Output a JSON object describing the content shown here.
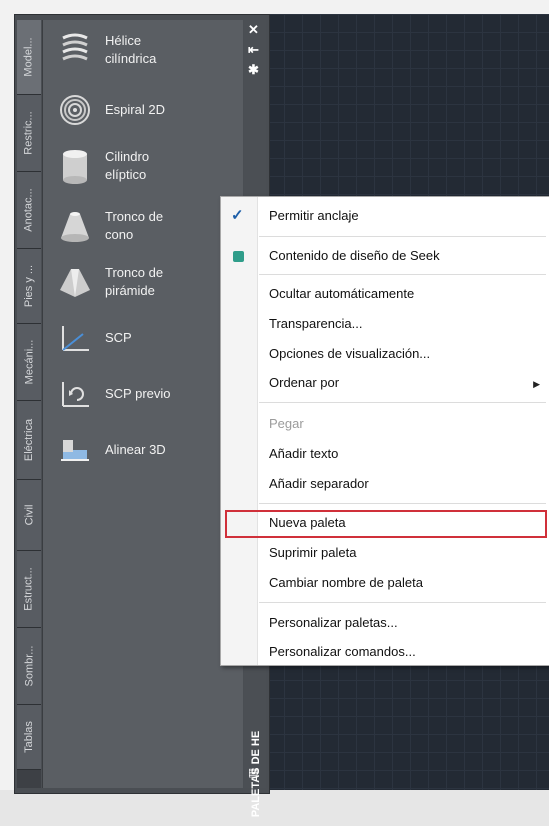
{
  "palette": {
    "title": "PALETAS DE HE",
    "tabs": [
      "Model...",
      "Restric...",
      "Anotac...",
      "Pies y ...",
      "Mecáni...",
      "Eléctrica",
      "Civil",
      "Estruct...",
      "Sombr...",
      "Tablas"
    ],
    "tools": [
      {
        "label": "Hélice\ncilíndrica",
        "icon": "helix-icon"
      },
      {
        "label": "Espiral 2D",
        "icon": "spiral-2d-icon"
      },
      {
        "label": "Cilindro\nelíptico",
        "icon": "elliptical-cylinder-icon"
      },
      {
        "label": "Tronco de\ncono",
        "icon": "cone-frustum-icon"
      },
      {
        "label": "Tronco de\npirámide",
        "icon": "pyramid-frustum-icon"
      },
      {
        "label": "SCP",
        "icon": "ucs-icon"
      },
      {
        "label": "SCP previo",
        "icon": "ucs-previous-icon"
      },
      {
        "label": "Alinear 3D",
        "icon": "align-3d-icon"
      }
    ],
    "titlebar_icons": [
      "close-icon",
      "autohide-icon",
      "properties-icon"
    ]
  },
  "context_menu": {
    "items": [
      {
        "label": "Permitir anclaje",
        "checked": true
      },
      {
        "label": "Contenido de diseño de Seek",
        "icon": "seek-icon"
      },
      {
        "label": "Ocultar automáticamente"
      },
      {
        "label": "Transparencia..."
      },
      {
        "label": "Opciones de visualización..."
      },
      {
        "label": "Ordenar por",
        "submenu": true
      },
      {
        "label": "Pegar",
        "disabled": true
      },
      {
        "label": "Añadir texto"
      },
      {
        "label": "Añadir separador"
      },
      {
        "label": "Nueva paleta",
        "highlighted": true
      },
      {
        "label": "Suprimir paleta"
      },
      {
        "label": "Cambiar nombre de paleta"
      },
      {
        "label": "Personalizar paletas..."
      },
      {
        "label": "Personalizar comandos..."
      }
    ]
  },
  "colors": {
    "highlight_border": "#d0303a",
    "check": "#1e5fa8",
    "canvas": "#232a34"
  }
}
